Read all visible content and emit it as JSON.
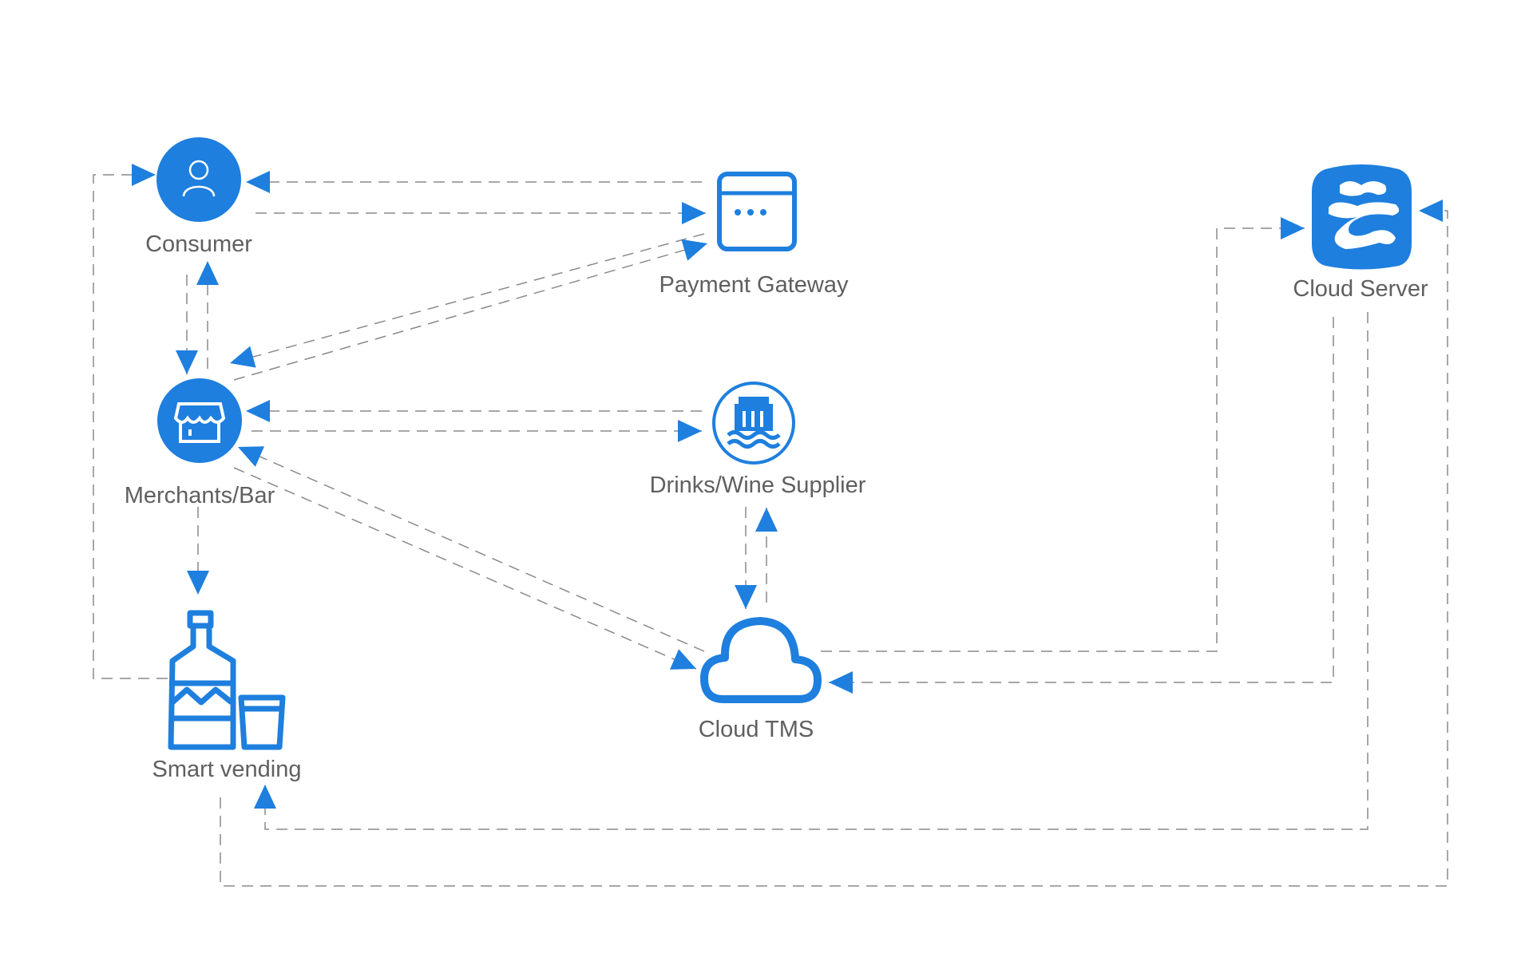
{
  "colors": {
    "accent": "#1e7fde",
    "edge": "#8a8a8a",
    "label": "#5f5f5f"
  },
  "nodes": {
    "consumer": {
      "label": "Consumer",
      "icon": "user-icon"
    },
    "payment_gateway": {
      "label": "Payment Gateway",
      "icon": "browser-window-icon"
    },
    "cloud_server": {
      "label": "Cloud Server",
      "icon": "cloud-server-logo-icon"
    },
    "merchants": {
      "label": "Merchants/Bar",
      "icon": "storefront-icon"
    },
    "supplier": {
      "label": "Drinks/Wine Supplier",
      "icon": "factory-icon"
    },
    "cloud_tms": {
      "label": "Cloud TMS",
      "icon": "cloud-icon"
    },
    "smart_vending": {
      "label": "Smart vending",
      "icon": "bottle-glass-icon"
    }
  },
  "edges": [
    {
      "from": "Smart vending",
      "to": "Consumer"
    },
    {
      "from": "Payment Gateway",
      "to": "Consumer"
    },
    {
      "from": "Consumer",
      "to": "Payment Gateway"
    },
    {
      "from": "Consumer",
      "to": "Merchants/Bar"
    },
    {
      "from": "Merchants/Bar",
      "to": "Consumer"
    },
    {
      "from": "Payment Gateway",
      "to": "Merchants/Bar"
    },
    {
      "from": "Merchants/Bar",
      "to": "Payment Gateway"
    },
    {
      "from": "Drinks/Wine Supplier",
      "to": "Merchants/Bar"
    },
    {
      "from": "Merchants/Bar",
      "to": "Drinks/Wine Supplier"
    },
    {
      "from": "Cloud TMS",
      "to": "Merchants/Bar"
    },
    {
      "from": "Merchants/Bar",
      "to": "Cloud TMS"
    },
    {
      "from": "Merchants/Bar",
      "to": "Smart vending"
    },
    {
      "from": "Drinks/Wine Supplier",
      "to": "Cloud TMS"
    },
    {
      "from": "Cloud TMS",
      "to": "Drinks/Wine Supplier"
    },
    {
      "from": "Cloud TMS",
      "to": "Cloud Server"
    },
    {
      "from": "Cloud Server",
      "to": "Cloud TMS"
    },
    {
      "from": "Cloud Server",
      "to": "Smart vending"
    },
    {
      "from": "Smart vending",
      "to": "Cloud Server"
    }
  ]
}
